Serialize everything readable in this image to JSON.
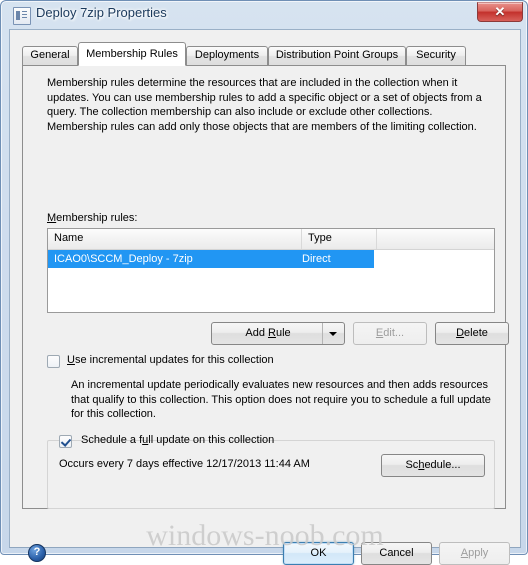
{
  "window": {
    "title": "Deploy 7zip Properties",
    "icon": "properties-document-icon",
    "close_label": "✕",
    "accent_selection": "#2196f3",
    "accent_default_button": "#3c7fb1"
  },
  "tabs": [
    {
      "label": "General",
      "active": false
    },
    {
      "label": "Membership Rules",
      "active": true
    },
    {
      "label": "Deployments",
      "active": false
    },
    {
      "label": "Distribution Point Groups",
      "active": false
    },
    {
      "label": "Security",
      "active": false
    }
  ],
  "panel": {
    "description": "Membership rules determine the resources that are included in the collection when it updates. You can use membership rules to add a specific object or a set of objects from a query. The collection membership can also include or exclude other collections. Membership rules can add only those objects that are members of the limiting collection.",
    "rules_label": "Membership rules:",
    "list": {
      "columns": [
        "Name",
        "Type",
        ""
      ],
      "rows": [
        {
          "name": "ICAO0\\SCCM_Deploy - 7zip",
          "type": "Direct",
          "selected": true
        }
      ]
    },
    "buttons": {
      "add_rule": "Add Rule",
      "add_rule_has_dropdown": true,
      "edit": "Edit...",
      "edit_enabled": false,
      "delete": "Delete",
      "delete_enabled": true
    },
    "incremental": {
      "checkbox_label": "Use incremental updates for this collection",
      "checked": false,
      "description": "An incremental update periodically evaluates new resources and then adds resources that qualify to this collection. This option does not require you to schedule a full update for this collection."
    },
    "schedule": {
      "checkbox_label": "Schedule a full update on this collection",
      "checked": true,
      "occurs_text": "Occurs every 7 days effective 12/17/2013 11:44 AM",
      "button_label": "Schedule..."
    }
  },
  "footer": {
    "help_icon": "help-question-icon",
    "help_glyph": "?",
    "ok": "OK",
    "cancel": "Cancel",
    "apply": "Apply",
    "apply_enabled": false
  },
  "watermark": "windows-noob.com"
}
